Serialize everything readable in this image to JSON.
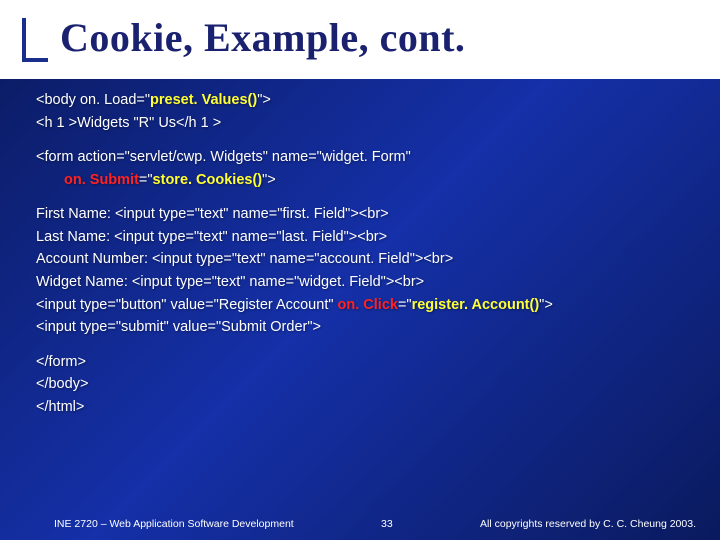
{
  "title": "Cookie, Example, cont.",
  "code": {
    "l01a": "<body on. Load=\"",
    "l01b": "preset. Values()",
    "l01c": "\">",
    "l02": "<h 1 >Widgets \"R\" Us</h 1 >",
    "l03": "<form action=\"servlet/cwp. Widgets\" name=\"widget. Form\"",
    "l04a": "on. Submit",
    "l04b": "=\"",
    "l04c": "store. Cookies()",
    "l04d": "\">",
    "l05": "First Name: <input type=\"text\" name=\"first. Field\"><br>",
    "l06": "Last Name: <input type=\"text\" name=\"last. Field\"><br>",
    "l07": "Account Number: <input type=\"text\" name=\"account. Field\"><br>",
    "l08": "Widget Name: <input type=\"text\" name=\"widget. Field\"><br>",
    "l09a": "<input type=\"button\" value=\"Register Account\" ",
    "l09b": "on. Click",
    "l09c": "=\"",
    "l09d": "register. Account()",
    "l09e": "\">",
    "l10": "<input type=\"submit\" value=\"Submit Order\">",
    "l11": "</form>",
    "l12": "</body>",
    "l13": "</html>"
  },
  "footer": {
    "left": "INE 2720 – Web Application Software Development",
    "center": "33",
    "right": "All copyrights reserved by C. C. Cheung 2003."
  }
}
